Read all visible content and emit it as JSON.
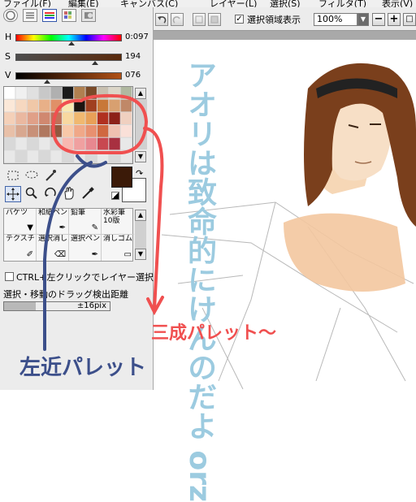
{
  "menu": {
    "items": [
      "ファイル(F)",
      "編集(E)",
      "キャンバス(C)",
      "レイヤー(L)",
      "選択(S)",
      "フィルタ(T)",
      "表示(V)"
    ]
  },
  "toolbar": {
    "selection_display_checked": true,
    "selection_display_label": "選択領域表示",
    "zoom": "100%",
    "minus_label": "−",
    "plus_label": "+",
    "reset_label": "□"
  },
  "sliders": {
    "h": {
      "label": "H",
      "value": "0:097"
    },
    "s": {
      "label": "S",
      "value": "194"
    },
    "v": {
      "label": "V",
      "value": "076"
    }
  },
  "brushes": [
    {
      "name": "バケツ",
      "size": ""
    },
    {
      "name": "和紙ペン",
      "size": ""
    },
    {
      "name": "鉛筆",
      "size": ""
    },
    {
      "name": "水彩筆",
      "size": "10版"
    },
    {
      "name": "テクスチャ",
      "size": ""
    },
    {
      "name": "選択消し",
      "size": ""
    },
    {
      "name": "選択ペン",
      "size": ""
    },
    {
      "name": "消しゴム",
      "size": ""
    }
  ],
  "options": {
    "ctrl_left_click_label": "CTRL+左クリックでレイヤー選択",
    "drag_distance_label": "選択・移動のドラッグ検出距離",
    "drag_distance_value": "±16pix"
  },
  "annotations": {
    "blue_note": "アオリは致命的にけんのだよ orz",
    "red_note": "三成パレット～",
    "navy_note": "左近パレット"
  },
  "colors": {
    "current_color": "#3b1a08",
    "annotation_red": "#f05050",
    "annotation_blue": "#9ccbe0",
    "annotation_navy": "#3c4f8a"
  }
}
